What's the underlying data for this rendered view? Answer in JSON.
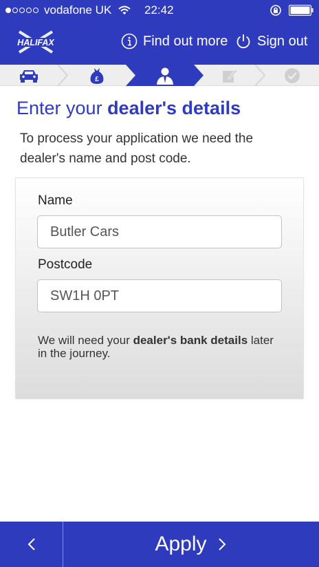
{
  "status_bar": {
    "signal_filled": 1,
    "signal_total": 5,
    "carrier": "vodafone UK",
    "time": "22:42"
  },
  "header": {
    "logo_text": "HALIFAX",
    "find_out_more": "Find out more",
    "sign_out": "Sign out"
  },
  "steps": {
    "items": [
      "car-icon",
      "money-bag-icon",
      "dealer-person-icon",
      "edit-icon",
      "checkmark-icon"
    ],
    "active_index": 2
  },
  "page": {
    "title_normal": "Enter your ",
    "title_bold": "dealer's details",
    "intro": "To process your application we need the dealer's name and post code."
  },
  "form": {
    "name_label": "Name",
    "name_value": "Butler Cars",
    "postcode_label": "Postcode",
    "postcode_value": "SW1H 0PT",
    "note_prefix": "We will need your ",
    "note_bold": "dealer's bank details",
    "note_suffix": " later in the journey."
  },
  "footer": {
    "apply_label": "Apply"
  },
  "colors": {
    "brand_blue": "#2f3bbd",
    "steps_bg": "#eeeeee"
  }
}
